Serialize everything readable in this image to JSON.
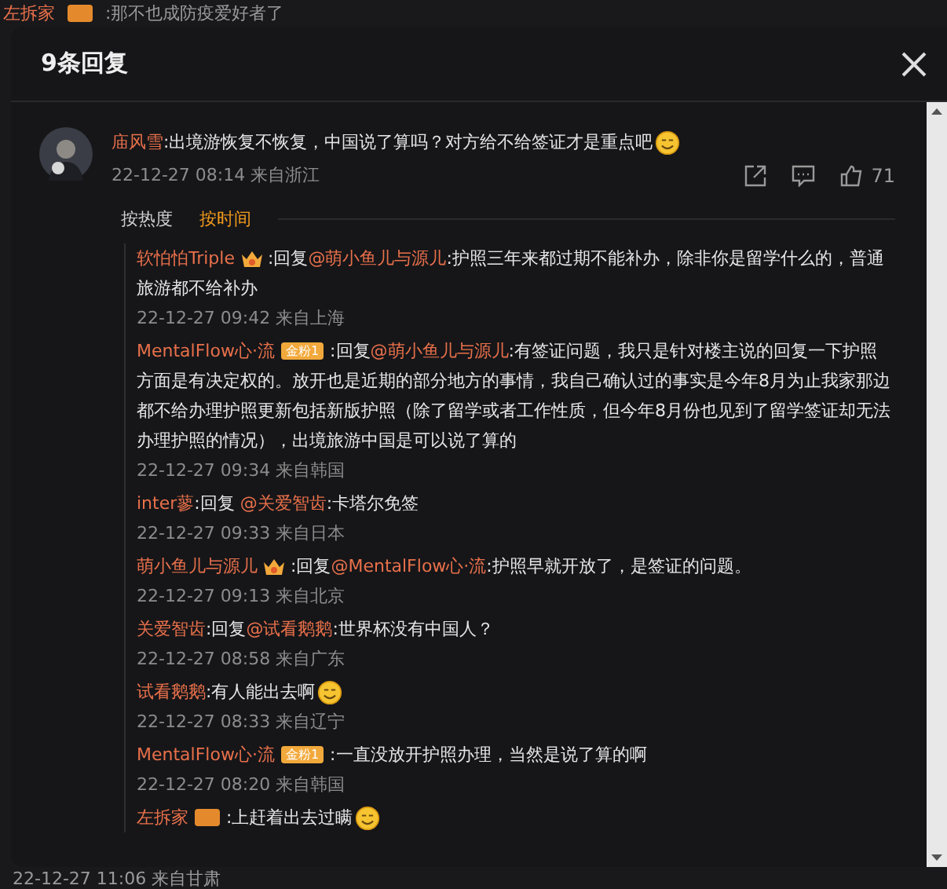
{
  "background": {
    "top_comment": {
      "name": "左拆家",
      "text": ":那不也成防疫爱好者了"
    },
    "bottom_time": "22-12-27 11:06 来自甘肃"
  },
  "dialog": {
    "title": "9条回复",
    "comment": {
      "name": "庙风雪",
      "text": ":出境游恢复不恢复，中国说了算吗？对方给不给签证才是重点吧",
      "emoji": true,
      "time": "22-12-27 08:14 来自浙江",
      "likes": "71"
    },
    "sort_tabs": [
      {
        "label": "按热度",
        "selected": false
      },
      {
        "label": "按时间",
        "selected": true
      }
    ],
    "replies": [
      {
        "name": "软怕怕Triple",
        "badge": {
          "kind": "crown"
        },
        "parts": [
          {
            "text": ":回复"
          },
          {
            "text": "@萌小鱼儿与源儿",
            "mention": true
          },
          {
            "text": ":护照三年来都过期不能补办，除非你是留学什么的，普通旅游都不给补办"
          }
        ],
        "time": "22-12-27 09:42 来自上海"
      },
      {
        "name": "MentalFlow心·流",
        "badge": {
          "kind": "fan",
          "label": "金粉1"
        },
        "parts": [
          {
            "text": ":回复"
          },
          {
            "text": "@萌小鱼儿与源儿",
            "mention": true
          },
          {
            "text": ":有签证问题，我只是针对楼主说的回复一下护照方面是有决定权的。放开也是近期的部分地方的事情，我自己确认过的事实是今年8月为止我家那边都不给办理护照更新包括新版护照（除了留学或者工作性质，但今年8月份也见到了留学签证却无法办理护照的情况），出境旅游中国是可以说了算的"
          }
        ],
        "time": "22-12-27 09:34 来自韩国"
      },
      {
        "name": "inter蓼",
        "parts": [
          {
            "text": ":回复 "
          },
          {
            "text": "@关爱智齿",
            "mention": true
          },
          {
            "text": ":卡塔尔免签"
          }
        ],
        "time": "22-12-27 09:33 来自日本"
      },
      {
        "name": "萌小鱼儿与源儿",
        "badge": {
          "kind": "crown"
        },
        "parts": [
          {
            "text": ":回复"
          },
          {
            "text": "@MentalFlow心·流",
            "mention": true
          },
          {
            "text": ":护照早就开放了，是签证的问题。"
          }
        ],
        "time": "22-12-27 09:13 来自北京"
      },
      {
        "name": "关爱智齿",
        "parts": [
          {
            "text": ":回复"
          },
          {
            "text": "@试看鹅鹅",
            "mention": true
          },
          {
            "text": ":世界杯没有中国人？"
          }
        ],
        "time": "22-12-27 08:58 来自广东"
      },
      {
        "name": "试看鹅鹅",
        "parts": [
          {
            "text": ":有人能出去啊"
          }
        ],
        "emoji": true,
        "time": "22-12-27 08:33 来自辽宁"
      },
      {
        "name": "MentalFlow心·流",
        "badge": {
          "kind": "fan",
          "label": "金粉1"
        },
        "parts": [
          {
            "text": ":一直没放开护照办理，当然是说了算的啊"
          }
        ],
        "time": "22-12-27 08:20 来自韩国"
      },
      {
        "name": "左拆家",
        "badge": {
          "kind": "tag"
        },
        "parts": [
          {
            "text": ":上赶着出去过瞒"
          }
        ],
        "emoji": true
      }
    ]
  }
}
